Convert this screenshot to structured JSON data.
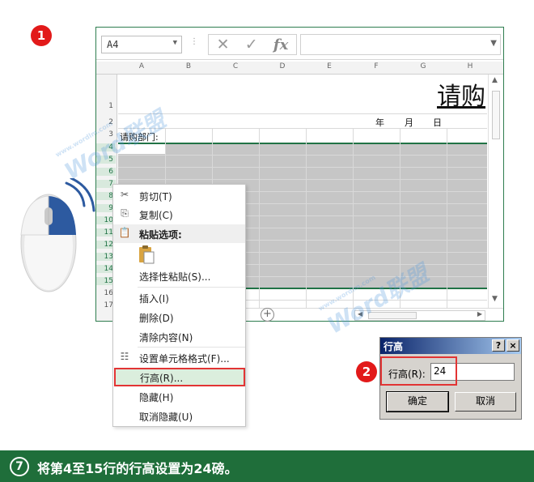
{
  "steps": {
    "badge1": "1",
    "badge2": "2"
  },
  "excel": {
    "name_box": "A4",
    "columns": [
      "A",
      "B",
      "C",
      "D",
      "E",
      "F",
      "G",
      "H"
    ],
    "rows": [
      "1",
      "2",
      "3",
      "4",
      "5",
      "6",
      "7",
      "8",
      "9",
      "10",
      "11",
      "12",
      "13",
      "14",
      "15",
      "16",
      "17"
    ],
    "title": "请购",
    "date_year": "年",
    "date_month": "月",
    "date_day": "日",
    "dept_label": "请购部门:"
  },
  "context_menu": {
    "cut": "剪切(T)",
    "copy": "复制(C)",
    "paste_options": "粘贴选项:",
    "paste_special": "选择性粘贴(S)...",
    "insert": "插入(I)",
    "delete": "删除(D)",
    "clear": "清除内容(N)",
    "format_cells": "设置单元格格式(F)...",
    "row_height": "行高(R)...",
    "hide": "隐藏(H)",
    "unhide": "取消隐藏(U)"
  },
  "dialog": {
    "title": "行高",
    "help": "?",
    "close": "×",
    "label": "行高(R):",
    "value": "24",
    "ok": "确定",
    "cancel": "取消"
  },
  "watermark": {
    "text": "Word联盟",
    "url": "www.wordlm.com"
  },
  "caption": {
    "number": "7",
    "text": "将第4至15行的行高设置为24磅。"
  },
  "colors": {
    "excel_green": "#217346",
    "caption_bg": "#1f6e3a",
    "highlight_red": "#e23434",
    "badge_red": "#e21a1a"
  }
}
